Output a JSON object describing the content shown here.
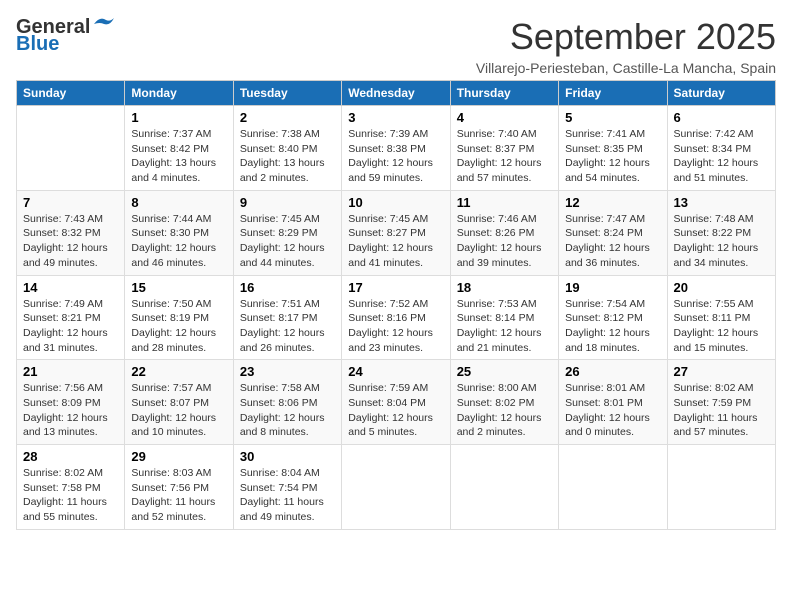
{
  "header": {
    "logo_line1": "General",
    "logo_line2": "Blue",
    "month_title": "September 2025",
    "location": "Villarejo-Periesteban, Castille-La Mancha, Spain"
  },
  "columns": [
    "Sunday",
    "Monday",
    "Tuesday",
    "Wednesday",
    "Thursday",
    "Friday",
    "Saturday"
  ],
  "weeks": [
    [
      {
        "day": "",
        "info": ""
      },
      {
        "day": "1",
        "info": "Sunrise: 7:37 AM\nSunset: 8:42 PM\nDaylight: 13 hours\nand 4 minutes."
      },
      {
        "day": "2",
        "info": "Sunrise: 7:38 AM\nSunset: 8:40 PM\nDaylight: 13 hours\nand 2 minutes."
      },
      {
        "day": "3",
        "info": "Sunrise: 7:39 AM\nSunset: 8:38 PM\nDaylight: 12 hours\nand 59 minutes."
      },
      {
        "day": "4",
        "info": "Sunrise: 7:40 AM\nSunset: 8:37 PM\nDaylight: 12 hours\nand 57 minutes."
      },
      {
        "day": "5",
        "info": "Sunrise: 7:41 AM\nSunset: 8:35 PM\nDaylight: 12 hours\nand 54 minutes."
      },
      {
        "day": "6",
        "info": "Sunrise: 7:42 AM\nSunset: 8:34 PM\nDaylight: 12 hours\nand 51 minutes."
      }
    ],
    [
      {
        "day": "7",
        "info": "Sunrise: 7:43 AM\nSunset: 8:32 PM\nDaylight: 12 hours\nand 49 minutes."
      },
      {
        "day": "8",
        "info": "Sunrise: 7:44 AM\nSunset: 8:30 PM\nDaylight: 12 hours\nand 46 minutes."
      },
      {
        "day": "9",
        "info": "Sunrise: 7:45 AM\nSunset: 8:29 PM\nDaylight: 12 hours\nand 44 minutes."
      },
      {
        "day": "10",
        "info": "Sunrise: 7:45 AM\nSunset: 8:27 PM\nDaylight: 12 hours\nand 41 minutes."
      },
      {
        "day": "11",
        "info": "Sunrise: 7:46 AM\nSunset: 8:26 PM\nDaylight: 12 hours\nand 39 minutes."
      },
      {
        "day": "12",
        "info": "Sunrise: 7:47 AM\nSunset: 8:24 PM\nDaylight: 12 hours\nand 36 minutes."
      },
      {
        "day": "13",
        "info": "Sunrise: 7:48 AM\nSunset: 8:22 PM\nDaylight: 12 hours\nand 34 minutes."
      }
    ],
    [
      {
        "day": "14",
        "info": "Sunrise: 7:49 AM\nSunset: 8:21 PM\nDaylight: 12 hours\nand 31 minutes."
      },
      {
        "day": "15",
        "info": "Sunrise: 7:50 AM\nSunset: 8:19 PM\nDaylight: 12 hours\nand 28 minutes."
      },
      {
        "day": "16",
        "info": "Sunrise: 7:51 AM\nSunset: 8:17 PM\nDaylight: 12 hours\nand 26 minutes."
      },
      {
        "day": "17",
        "info": "Sunrise: 7:52 AM\nSunset: 8:16 PM\nDaylight: 12 hours\nand 23 minutes."
      },
      {
        "day": "18",
        "info": "Sunrise: 7:53 AM\nSunset: 8:14 PM\nDaylight: 12 hours\nand 21 minutes."
      },
      {
        "day": "19",
        "info": "Sunrise: 7:54 AM\nSunset: 8:12 PM\nDaylight: 12 hours\nand 18 minutes."
      },
      {
        "day": "20",
        "info": "Sunrise: 7:55 AM\nSunset: 8:11 PM\nDaylight: 12 hours\nand 15 minutes."
      }
    ],
    [
      {
        "day": "21",
        "info": "Sunrise: 7:56 AM\nSunset: 8:09 PM\nDaylight: 12 hours\nand 13 minutes."
      },
      {
        "day": "22",
        "info": "Sunrise: 7:57 AM\nSunset: 8:07 PM\nDaylight: 12 hours\nand 10 minutes."
      },
      {
        "day": "23",
        "info": "Sunrise: 7:58 AM\nSunset: 8:06 PM\nDaylight: 12 hours\nand 8 minutes."
      },
      {
        "day": "24",
        "info": "Sunrise: 7:59 AM\nSunset: 8:04 PM\nDaylight: 12 hours\nand 5 minutes."
      },
      {
        "day": "25",
        "info": "Sunrise: 8:00 AM\nSunset: 8:02 PM\nDaylight: 12 hours\nand 2 minutes."
      },
      {
        "day": "26",
        "info": "Sunrise: 8:01 AM\nSunset: 8:01 PM\nDaylight: 12 hours\nand 0 minutes."
      },
      {
        "day": "27",
        "info": "Sunrise: 8:02 AM\nSunset: 7:59 PM\nDaylight: 11 hours\nand 57 minutes."
      }
    ],
    [
      {
        "day": "28",
        "info": "Sunrise: 8:02 AM\nSunset: 7:58 PM\nDaylight: 11 hours\nand 55 minutes."
      },
      {
        "day": "29",
        "info": "Sunrise: 8:03 AM\nSunset: 7:56 PM\nDaylight: 11 hours\nand 52 minutes."
      },
      {
        "day": "30",
        "info": "Sunrise: 8:04 AM\nSunset: 7:54 PM\nDaylight: 11 hours\nand 49 minutes."
      },
      {
        "day": "",
        "info": ""
      },
      {
        "day": "",
        "info": ""
      },
      {
        "day": "",
        "info": ""
      },
      {
        "day": "",
        "info": ""
      }
    ]
  ]
}
